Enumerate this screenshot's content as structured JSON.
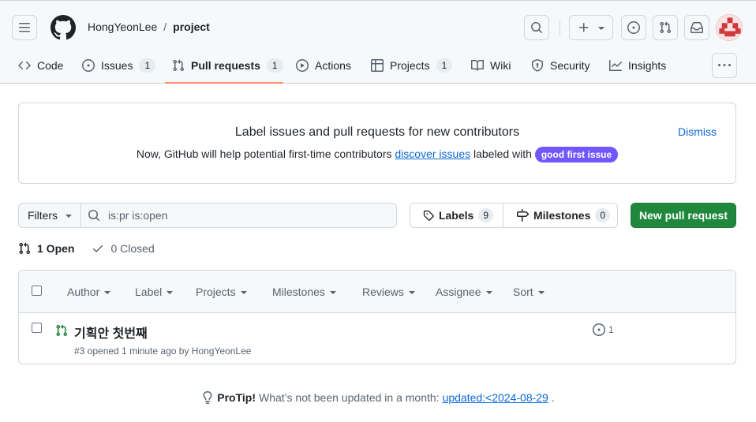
{
  "header": {
    "owner": "HongYeonLee",
    "separator": "/",
    "repo": "project",
    "icons": [
      "menu-icon",
      "github-logo-icon",
      "search-icon",
      "plus-icon",
      "issue-opened-icon",
      "pull-request-icon",
      "inbox-icon",
      "avatar"
    ]
  },
  "tabs": [
    {
      "label": "Code",
      "icon": "code-icon"
    },
    {
      "label": "Issues",
      "count": "1",
      "icon": "issue-opened-icon"
    },
    {
      "label": "Pull requests",
      "count": "1",
      "icon": "pull-request-icon",
      "active": true
    },
    {
      "label": "Actions",
      "icon": "play-icon"
    },
    {
      "label": "Projects",
      "count": "1",
      "icon": "table-icon"
    },
    {
      "label": "Wiki",
      "icon": "book-icon"
    },
    {
      "label": "Security",
      "icon": "shield-icon"
    },
    {
      "label": "Insights",
      "icon": "graph-icon"
    }
  ],
  "banner": {
    "title": "Label issues and pull requests for new contributors",
    "body_prefix": "Now, GitHub will help potential first-time contributors",
    "link": "discover issues",
    "body_middle": "labeled with",
    "label": "good first issue",
    "dismiss": "Dismiss"
  },
  "filter_bar": {
    "filters": "Filters",
    "search_value": "is:pr is:open",
    "labels": "Labels",
    "labels_count": "9",
    "milestones": "Milestones",
    "milestones_count": "0",
    "new_pr": "New pull request"
  },
  "states": {
    "open": "1 Open",
    "closed": "0 Closed"
  },
  "list_header": [
    "Author",
    "Label",
    "Projects",
    "Milestones",
    "Reviews",
    "Assignee",
    "Sort"
  ],
  "pull_requests": [
    {
      "title": "기획안 첫번째",
      "meta": "#3 opened 1 minute ago by HongYeonLee",
      "comments": "1"
    }
  ],
  "protip": {
    "label": "ProTip!",
    "text": "What’s not been updated in a month:",
    "link": "updated:<2024-08-29",
    "suffix": "."
  },
  "colors": {
    "accent_link": "#0969da",
    "primary_button": "#1f883d",
    "label_good_first_issue": "#7057ff",
    "tab_underline": "#fd8c73",
    "open_icon": "#1a7f37"
  }
}
